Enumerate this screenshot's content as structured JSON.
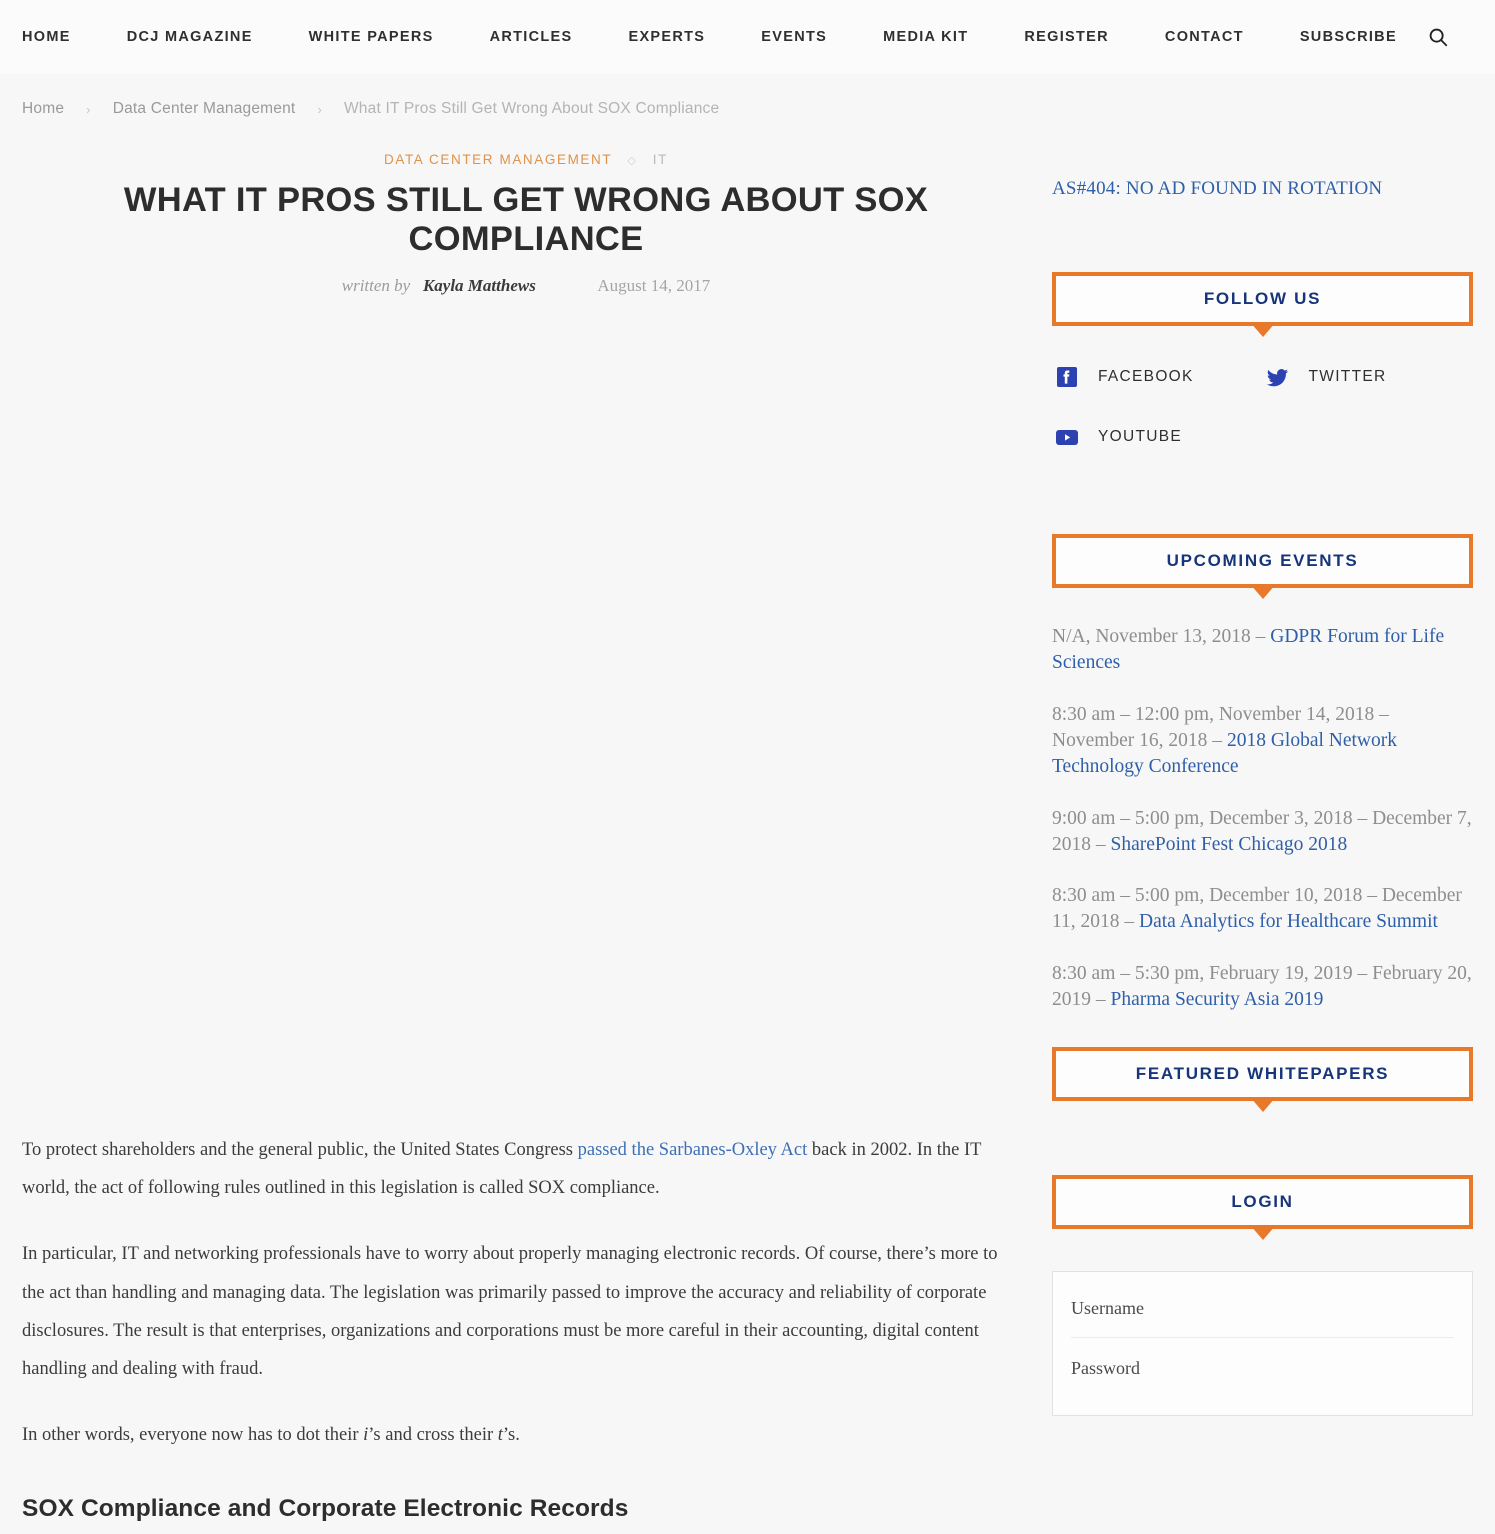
{
  "theme": {
    "accent_orange": "#e8782a",
    "accent_blue": "#17357a",
    "link_blue": "#2f5fa8",
    "category_orange": "#e0924a",
    "page_bg": "#f7f7f7"
  },
  "topnav": {
    "items": [
      {
        "label": "HOME"
      },
      {
        "label": "DCJ MAGAZINE"
      },
      {
        "label": "WHITE PAPERS"
      },
      {
        "label": "ARTICLES"
      },
      {
        "label": "EXPERTS"
      },
      {
        "label": "EVENTS"
      },
      {
        "label": "MEDIA KIT"
      },
      {
        "label": "REGISTER"
      },
      {
        "label": "CONTACT"
      },
      {
        "label": "SUBSCRIBE"
      }
    ],
    "search_icon": "search-icon"
  },
  "breadcrumb": {
    "items": [
      {
        "label": "Home",
        "current": false
      },
      {
        "label": "Data Center Management",
        "current": false
      },
      {
        "label": "What IT Pros Still Get Wrong About SOX Compliance",
        "current": true
      }
    ],
    "separator": "›"
  },
  "article": {
    "categories": [
      {
        "label": "DATA CENTER MANAGEMENT",
        "muted": false
      },
      {
        "label": "IT",
        "muted": true
      }
    ],
    "category_separator": "◇",
    "title": "WHAT IT PROS STILL GET WRONG ABOUT SOX COMPLIANCE",
    "byline_prefix": "written by",
    "author": "Kayla Matthews",
    "date": "August 14, 2017",
    "paragraphs": [
      {
        "before": "To protect shareholders and the general public, the United States Congress ",
        "link": "passed the Sarbanes-Oxley Act",
        "after": " back in 2002. In the IT world, the act of following rules outlined in this legislation is called SOX compliance."
      },
      {
        "text": "In particular, IT and networking professionals have to worry about properly managing electronic records. Of course, there’s more to the act than handling and managing data. The legislation was primarily passed to improve the accuracy and reliability of corporate disclosures. The result is that enterprises, organizations and corporations must be more careful in their accounting, digital content handling and dealing with fraud."
      },
      {
        "before": "In other words, everyone now has to dot their ",
        "italic1": "i",
        "mid": "’s and cross their ",
        "italic2": "t",
        "after": "’s."
      }
    ],
    "section_heading": "SOX Compliance and Corporate Electronic Records"
  },
  "sidebar": {
    "ad_slot": "AS#404: NO AD FOUND IN ROTATION",
    "follow_us": {
      "title": "FOLLOW US",
      "items": [
        {
          "label": "FACEBOOK",
          "icon": "facebook-icon"
        },
        {
          "label": "TWITTER",
          "icon": "twitter-icon"
        },
        {
          "label": "YOUTUBE",
          "icon": "youtube-icon"
        }
      ]
    },
    "upcoming_events": {
      "title": "UPCOMING EVENTS",
      "items": [
        {
          "when": "N/A, November 13, 2018 – ",
          "name": "GDPR Forum for Life Sciences"
        },
        {
          "when": "8:30 am – 12:00 pm, November 14, 2018 – November 16, 2018 – ",
          "name": "2018 Global Network Technology Conference"
        },
        {
          "when": "9:00 am – 5:00 pm, December 3, 2018 – December 7, 2018 – ",
          "name": "SharePoint Fest Chicago 2018"
        },
        {
          "when": "8:30 am – 5:00 pm, December 10, 2018 – December 11, 2018 – ",
          "name": "Data Analytics for Healthcare Summit"
        },
        {
          "when": "8:30 am – 5:30 pm, February 19, 2019 – February 20, 2019 – ",
          "name": "Pharma Security Asia 2019"
        }
      ]
    },
    "featured_whitepapers": {
      "title": "FEATURED WHITEPAPERS"
    },
    "login": {
      "title": "LOGIN",
      "username_placeholder": "Username",
      "username_value": "",
      "password_placeholder": "Password",
      "password_value": ""
    }
  }
}
